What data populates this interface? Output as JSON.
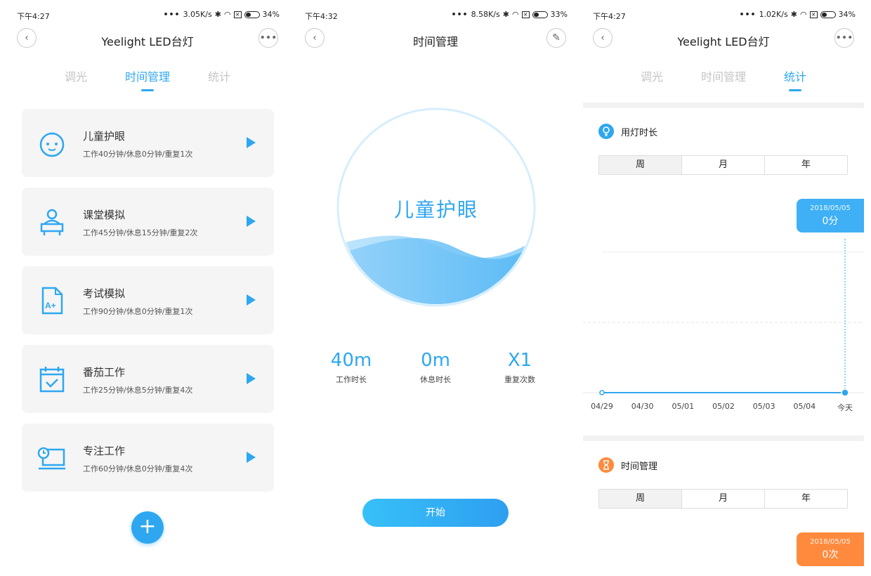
{
  "panel1": {
    "status": {
      "time": "下午4:27",
      "speed": "3.05K/s",
      "battery": "34%"
    },
    "nav": {
      "title": "Yeelight LED台灯"
    },
    "tabs": [
      "调光",
      "时间管理",
      "统计"
    ],
    "modes": [
      {
        "name": "儿童护眼",
        "desc": "工作40分钟/休息0分钟/重复1次",
        "icon": "baby-face-icon"
      },
      {
        "name": "课堂模拟",
        "desc": "工作45分钟/休息15分钟/重复2次",
        "icon": "student-desk-icon"
      },
      {
        "name": "考试模拟",
        "desc": "工作90分钟/休息0分钟/重复1次",
        "icon": "exam-paper-icon"
      },
      {
        "name": "番茄工作",
        "desc": "工作25分钟/休息5分钟/重复4次",
        "icon": "calendar-check-icon"
      },
      {
        "name": "专注工作",
        "desc": "工作60分钟/休息0分钟/重复4次",
        "icon": "clock-screen-icon"
      }
    ],
    "add_label": "+"
  },
  "panel2": {
    "status": {
      "time": "下午4:32",
      "speed": "8.58K/s",
      "battery": "33%"
    },
    "nav": {
      "title": "时间管理"
    },
    "timer_title": "儿童护眼",
    "stats": [
      {
        "value": "40m",
        "label": "工作时长"
      },
      {
        "value": "0m",
        "label": "休息时长"
      },
      {
        "value": "X1",
        "label": "重复次数"
      }
    ],
    "start_label": "开始"
  },
  "panel3": {
    "status": {
      "time": "下午4:27",
      "speed": "1.02K/s",
      "battery": "34%"
    },
    "nav": {
      "title": "Yeelight LED台灯"
    },
    "tabs": [
      "调光",
      "时间管理",
      "统计"
    ],
    "usage": {
      "title": "用灯时长",
      "segments": [
        "周",
        "月",
        "年"
      ],
      "tooltip": {
        "date": "2018/05/05",
        "value": "0分"
      },
      "chart_color": "#2ea7f0"
    },
    "time_mgmt": {
      "title": "时间管理",
      "segments": [
        "周",
        "月",
        "年"
      ],
      "tooltip": {
        "date": "2018/05/05",
        "value": "0次"
      },
      "accent": "#ff8a3d"
    }
  },
  "chart_data": {
    "type": "line",
    "x": [
      "04/29",
      "04/30",
      "05/01",
      "05/02",
      "05/03",
      "05/04",
      "今天"
    ],
    "series": [
      {
        "values": [
          0,
          0,
          0,
          0,
          0,
          0,
          0
        ]
      }
    ],
    "title": "用灯时长",
    "grid": true
  },
  "colors": {
    "accent": "#2ea7f0",
    "card_bg": "#f5f5f5",
    "orange": "#ff8a3d"
  }
}
